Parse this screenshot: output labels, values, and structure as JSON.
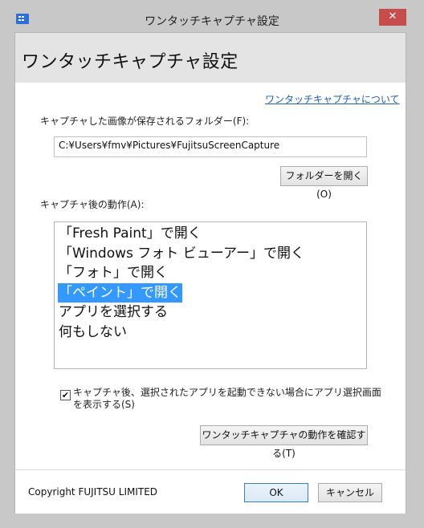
{
  "window": {
    "title": "ワンタッチキャプチャ設定",
    "close_glyph": "✕"
  },
  "header": {
    "title": "ワンタッチキャプチャ設定"
  },
  "about_link": "ワンタッチキャプチャについて",
  "folder": {
    "label": "キャプチャした画像が保存されるフォルダー(F):",
    "path": "C:¥Users¥fmv¥Pictures¥FujitsuScreenCapture",
    "open_button": "フォルダーを開く(O)"
  },
  "action": {
    "label": "キャプチャ後の動作(A):",
    "items": [
      {
        "label": "「Fresh Paint」で開く",
        "selected": false
      },
      {
        "label": "「Windows フォト ビューアー」で開く",
        "selected": false
      },
      {
        "label": "「フォト」で開く",
        "selected": false
      },
      {
        "label": "「ペイント」で開く",
        "selected": true
      },
      {
        "label": "アプリを選択する",
        "selected": false
      },
      {
        "label": "何もしない",
        "selected": false
      }
    ]
  },
  "option": {
    "checked": true,
    "check_glyph": "✔",
    "label": "キャプチャ後、選択されたアプリを起動できない場合にアプリ選択画面を表示する(S)"
  },
  "confirm_button": "ワンタッチキャプチャの動作を確認する(T)",
  "footer": {
    "copyright": "Copyright FUJITSU LIMITED",
    "ok_button": "OK",
    "cancel_button": "キャンセル"
  },
  "colors": {
    "selection": "#3399ff",
    "close_button": "#c74c4c",
    "link": "#2060a8",
    "ok_border": "#3c7fb1"
  }
}
